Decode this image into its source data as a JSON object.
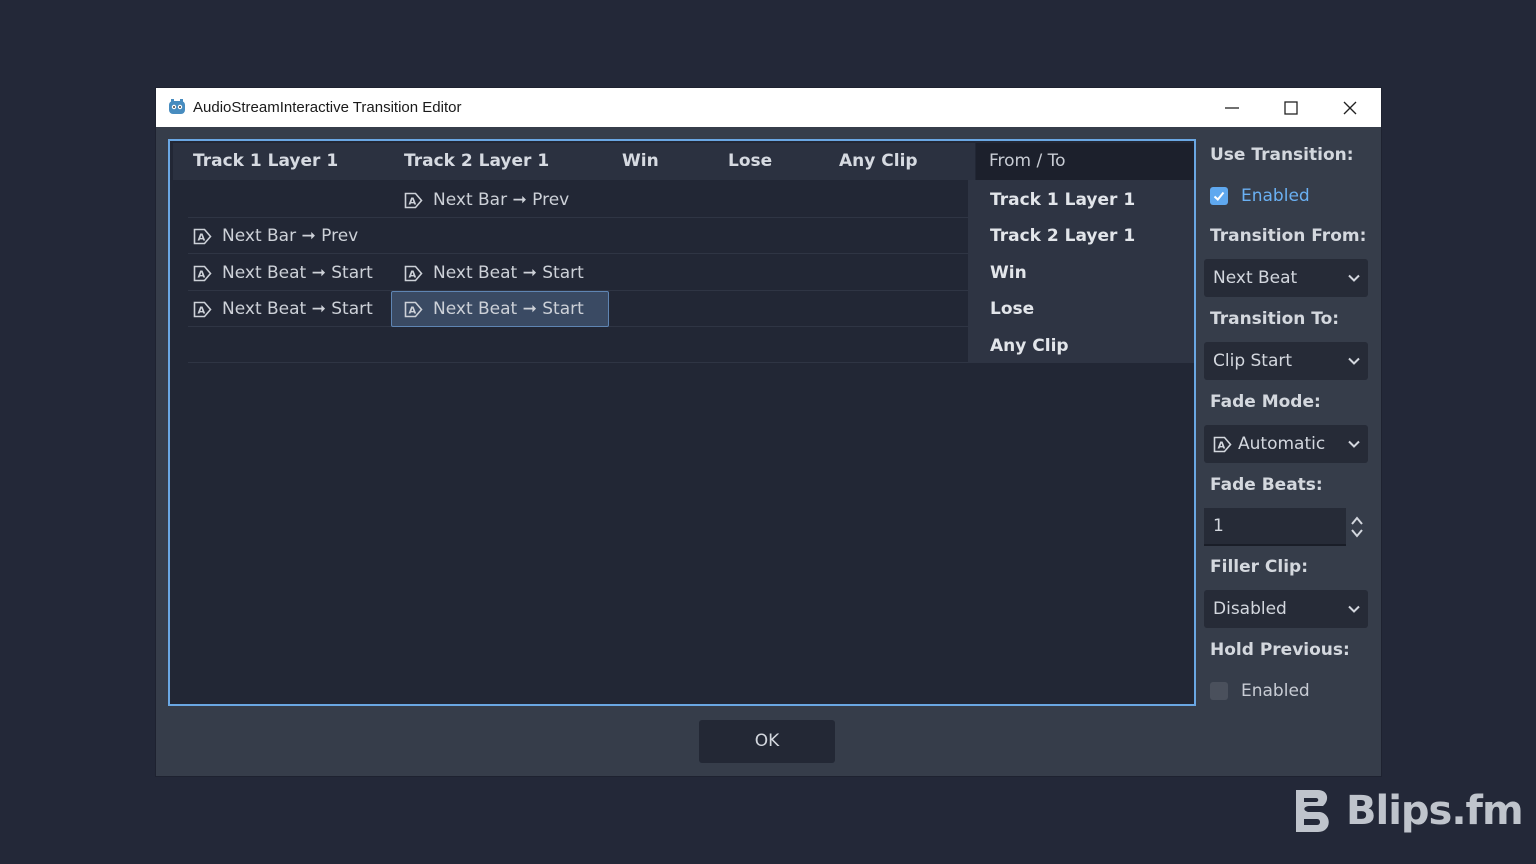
{
  "window": {
    "title": "AudioStreamInteractive Transition Editor",
    "icons": [
      "app-icon",
      "minimize-icon",
      "maximize-icon",
      "close-icon"
    ]
  },
  "grid": {
    "columns": [
      "Track 1 Layer 1",
      "Track 2 Layer 1",
      "Win",
      "Lose",
      "Any Clip"
    ],
    "corner_label": "From / To",
    "rows": [
      "Track 1 Layer 1",
      "Track 2 Layer 1",
      "Win",
      "Lose",
      "Any Clip"
    ],
    "cells": [
      {
        "row": 0,
        "col": 1,
        "text": "Next Bar ➞ Prev"
      },
      {
        "row": 1,
        "col": 0,
        "text": "Next Bar ➞ Prev"
      },
      {
        "row": 2,
        "col": 0,
        "text": "Next Beat ➞ Start"
      },
      {
        "row": 2,
        "col": 1,
        "text": "Next Beat ➞ Start"
      },
      {
        "row": 3,
        "col": 0,
        "text": "Next Beat ➞ Start"
      },
      {
        "row": 3,
        "col": 1,
        "text": "Next Beat ➞ Start",
        "selected": true
      }
    ],
    "cell_icon": "fade-auto-icon"
  },
  "props": {
    "use_transition_label": "Use Transition:",
    "use_transition_value": "Enabled",
    "use_transition_checked": true,
    "transition_from_label": "Transition From:",
    "transition_from_value": "Next Beat",
    "transition_to_label": "Transition To:",
    "transition_to_value": "Clip Start",
    "fade_mode_label": "Fade Mode:",
    "fade_mode_value": "Automatic",
    "fade_beats_label": "Fade Beats:",
    "fade_beats_value": "1",
    "filler_clip_label": "Filler Clip:",
    "filler_clip_value": "Disabled",
    "hold_previous_label": "Hold Previous:",
    "hold_previous_value": "Enabled",
    "hold_previous_checked": false
  },
  "ok_label": "OK",
  "brand": "Blips.fm",
  "colors": {
    "accent": "#6aa7e3",
    "checkbox_on": "#5fa8ef",
    "background": "#232838",
    "panel": "#363d4a",
    "selected_cell": "#3a4a63"
  }
}
